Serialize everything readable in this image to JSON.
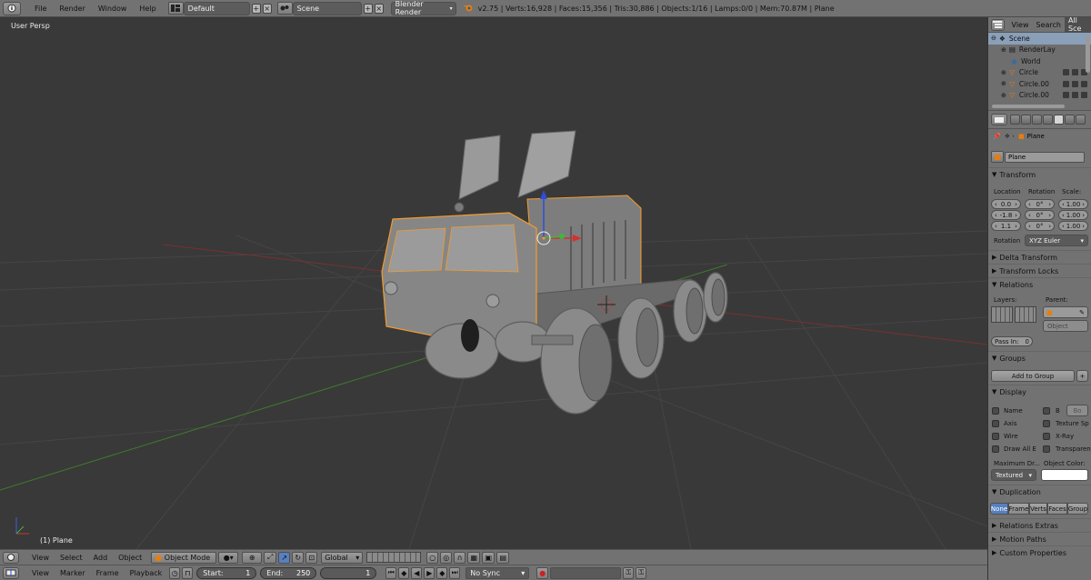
{
  "topbar": {
    "menu": [
      "File",
      "Render",
      "Window",
      "Help"
    ],
    "screen_layout": "Default",
    "scene": "Scene",
    "render_engine": "Blender Render",
    "stats": "v2.75 | Verts:16,928 | Faces:15,356 | Tris:30,886 | Objects:1/16 | Lamps:0/0 | Mem:70.87M | Plane"
  },
  "viewport": {
    "view_name": "User Persp",
    "object_label": "(1) Plane"
  },
  "view3d_header": {
    "menu": [
      "View",
      "Select",
      "Add",
      "Object"
    ],
    "mode": "Object Mode",
    "orientation": "Global"
  },
  "timeline_header": {
    "menu": [
      "View",
      "Marker",
      "Frame",
      "Playback"
    ],
    "start_label": "Start:",
    "start_value": "1",
    "end_label": "End:",
    "end_value": "250",
    "current_frame": "1",
    "sync": "No Sync"
  },
  "outliner": {
    "header": [
      "View",
      "Search",
      "All Sce"
    ],
    "items": [
      "Scene",
      "RenderLay",
      "World",
      "Circle",
      "Circle.00",
      "Circle.00"
    ]
  },
  "properties": {
    "breadcrumb": "Plane",
    "object_name": "Plane",
    "transform": {
      "title": "Transform",
      "location_label": "Location",
      "rotation_label": "Rotation",
      "scale_label": "Scale:",
      "location": [
        "0.0",
        "-1.8",
        "1.1"
      ],
      "rotation": [
        "0°",
        "0°",
        "0°"
      ],
      "scale": [
        "1.00",
        "1.00",
        "1.00"
      ],
      "rotation_mode_label": "Rotation",
      "rotation_mode": "XYZ Euler"
    },
    "delta_transform": "Delta Transform",
    "transform_locks": "Transform Locks",
    "relations": {
      "title": "Relations",
      "layers_label": "Layers:",
      "parent_label": "Parent:",
      "parent_type": "Object",
      "pass_index": "Pass In:",
      "pass_value": "0"
    },
    "groups": {
      "title": "Groups",
      "add_button": "Add to Group"
    },
    "display": {
      "title": "Display",
      "checks": [
        "Name",
        "B",
        "Axis",
        "Texture Sp",
        "Wire",
        "X-Ray",
        "Draw All E",
        "Transparen"
      ],
      "bounds_value": "Bo",
      "max_draw_label": "Maximum Dr...",
      "object_color_label": "Object Color:",
      "max_draw_value": "Textured"
    },
    "duplication": {
      "title": "Duplication",
      "options": [
        "None",
        "Frame",
        "Verts",
        "Faces",
        "Group"
      ]
    },
    "relations_extras": "Relations Extras",
    "motion_paths": "Motion Paths",
    "custom_properties": "Custom Properties"
  },
  "colors": {
    "header_bg": "#727272",
    "viewport_bg": "#393939",
    "selection_outline": "#f39c2e",
    "active_blue": "#5680c2"
  }
}
